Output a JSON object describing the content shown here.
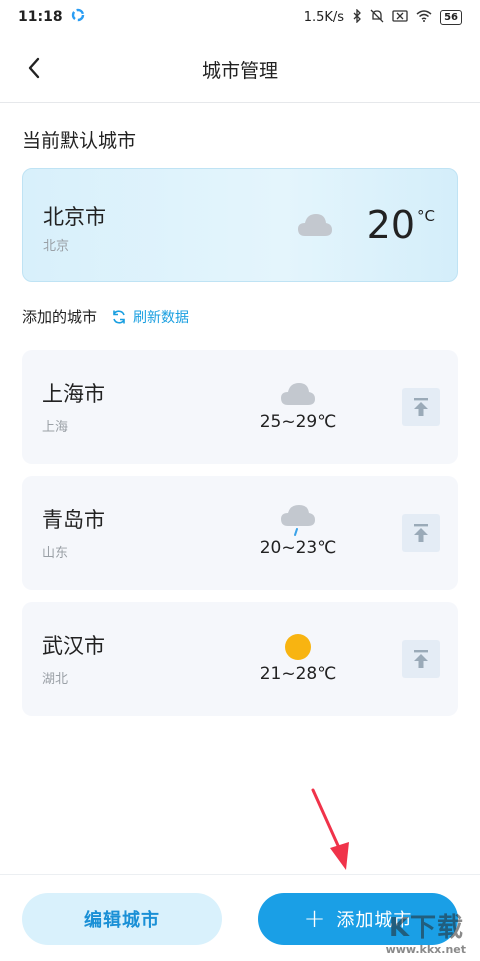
{
  "status": {
    "time": "11:18",
    "network_speed": "1.5K/s",
    "battery": "56"
  },
  "header": {
    "title": "城市管理"
  },
  "default_section": {
    "title": "当前默认城市",
    "city": {
      "name": "北京市",
      "region": "北京",
      "temp": "20",
      "unit": "°C",
      "weather_icon": "cloud-icon"
    }
  },
  "added_section": {
    "label": "添加的城市",
    "refresh_label": "刷新数据"
  },
  "cities": [
    {
      "name": "上海市",
      "region": "上海",
      "range": "25~29℃",
      "weather_icon": "cloud-icon"
    },
    {
      "name": "青岛市",
      "region": "山东",
      "range": "20~23℃",
      "weather_icon": "rain-cloud-icon"
    },
    {
      "name": "武汉市",
      "region": "湖北",
      "range": "21~28℃",
      "weather_icon": "sun-icon"
    }
  ],
  "bottom": {
    "edit_label": "编辑城市",
    "add_plus": "+",
    "add_label": "添加城市"
  },
  "watermark": {
    "big": "K下载",
    "site": "www.kkx.net"
  },
  "colors": {
    "accent": "#1a9fe6",
    "accent_text": "#1a90d6",
    "card_bg": "#f5f7fb",
    "arrow": "#f0334a"
  }
}
